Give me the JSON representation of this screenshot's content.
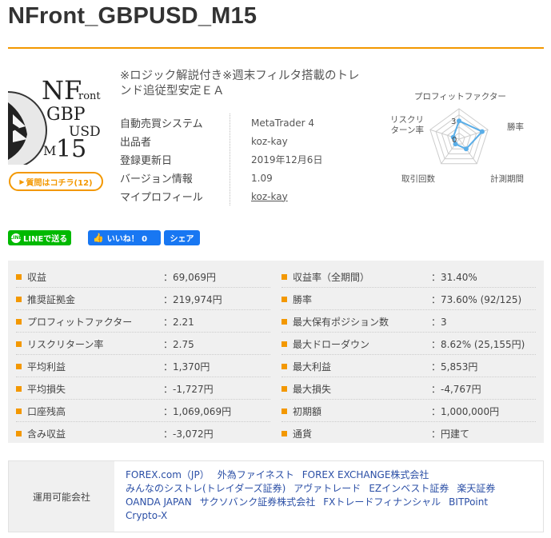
{
  "page": {
    "title": "NFront_GBPUSD_M15"
  },
  "logo": {
    "lines": [
      "NF",
      "ront",
      "GBP",
      "USD",
      "M",
      "15"
    ]
  },
  "question_button": {
    "label": "質問はコチラ(12)"
  },
  "product": {
    "tagline": "※ロジック解説付き※週末フィルタ搭載のトレンド追従型安定ＥＡ",
    "info": [
      {
        "key": "自動売買システム",
        "value": "MetaTrader 4"
      },
      {
        "key": "出品者",
        "value": "koz-kay"
      },
      {
        "key": "登録更新日",
        "value": "2019年12月6日"
      },
      {
        "key": "バージョン情報",
        "value": "1.09"
      },
      {
        "key": "マイプロフィール",
        "value": "koz-kay"
      }
    ]
  },
  "radar": {
    "axes": [
      "プロフィットファクター",
      "勝率",
      "計測期間",
      "取引回数",
      "リスクリターン率"
    ],
    "values": [
      3,
      4,
      2,
      1,
      1
    ],
    "max": 5,
    "center_label": "0",
    "scale_label": "3",
    "fill_color": "#5aaee8",
    "grid_color": "#cccccc"
  },
  "share": {
    "line_label": "LINEで送る",
    "line_badge": "LINE",
    "like_label": "いいね！ 0",
    "share_label": "シェア"
  },
  "stats": {
    "left": [
      {
        "key": "収益",
        "value": "：69,069円"
      },
      {
        "key": "推奨証拠金",
        "value": "：219,974円"
      },
      {
        "key": "プロフィットファクター",
        "value": "：2.21"
      },
      {
        "key": "リスクリターン率",
        "value": "：2.75"
      },
      {
        "key": "平均利益",
        "value": "：1,370円"
      },
      {
        "key": "平均損失",
        "value": "：-1,727円"
      },
      {
        "key": "口座残高",
        "value": "：1,069,069円"
      },
      {
        "key": "含み収益",
        "value": "：-3,072円"
      }
    ],
    "right": [
      {
        "key": "収益率（全期間）",
        "value": "：31.40%"
      },
      {
        "key": "勝率",
        "value": "：73.60% (92/125)"
      },
      {
        "key": "最大保有ポジション数",
        "value": "：3"
      },
      {
        "key": "最大ドローダウン",
        "value": "：8.62% (25,155円)"
      },
      {
        "key": "最大利益",
        "value": "：5,853円"
      },
      {
        "key": "最大損失",
        "value": "：-4,767円"
      },
      {
        "key": "初期額",
        "value": "：1,000,000円"
      },
      {
        "key": "通貨",
        "value": "：円建て"
      }
    ]
  },
  "brokers": {
    "label": "運用可能会社",
    "items": [
      "FOREX.com（JP）",
      "外為ファイネスト",
      "FOREX EXCHANGE株式会社",
      "みんなのシストレ(トレイダーズ証券)",
      "アヴァトレード",
      "EZインベスト証券",
      "楽天証券",
      "OANDA JAPAN",
      "サクソバンク証券株式会社",
      "FXトレードフィナンシャル",
      "BITPoint",
      "Crypto-X"
    ]
  },
  "colors": {
    "accent": "#f39800",
    "line_green": "#00b900",
    "facebook": "#1877f2",
    "link": "#2b4fa6"
  }
}
